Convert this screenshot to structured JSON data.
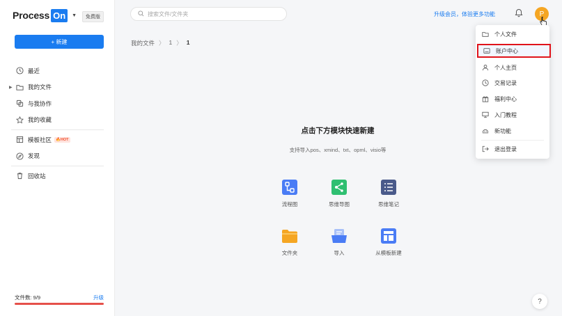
{
  "brand": {
    "logo_text": "Process",
    "logo_on": "On",
    "plan_badge": "免费版"
  },
  "sidebar": {
    "new_button": "+ 新建",
    "items": [
      {
        "label": "最近",
        "icon": "clock-icon"
      },
      {
        "label": "我的文件",
        "icon": "folder-icon"
      },
      {
        "label": "与我协作",
        "icon": "collab-icon"
      },
      {
        "label": "我的收藏",
        "icon": "star-icon"
      },
      {
        "label": "模板社区",
        "icon": "template-icon",
        "badge": "HOT"
      },
      {
        "label": "发现",
        "icon": "compass-icon"
      },
      {
        "label": "回收站",
        "icon": "trash-icon"
      }
    ],
    "files_label": "文件数: 9/9",
    "upgrade_label": "升级",
    "files_used": 9,
    "files_total": 9
  },
  "header": {
    "search_placeholder": "搜索文件/文件夹",
    "upgrade_text": "升级会员，体验更多功能",
    "avatar_letter": "P"
  },
  "breadcrumb": {
    "root": "我的文件",
    "level1": "1",
    "current": "1"
  },
  "main": {
    "title": "点击下方模块快速新建",
    "subtitle": "支持导入pos、xmind、txt、opml、visio等",
    "tiles": [
      {
        "label": "流程图",
        "icon": "flowchart-icon",
        "color": "#4a7cf5"
      },
      {
        "label": "思维导图",
        "icon": "mindmap-icon",
        "color": "#2fbf71"
      },
      {
        "label": "思维笔记",
        "icon": "notes-icon",
        "color": "#4a5a8a"
      },
      {
        "label": "文件夹",
        "icon": "folder-icon",
        "color": "#f5a623"
      },
      {
        "label": "导入",
        "icon": "import-icon",
        "color": "#4a7cf5"
      },
      {
        "label": "从模板新建",
        "icon": "template-icon",
        "color": "#4a7cf5"
      }
    ]
  },
  "menu": {
    "items": [
      {
        "label": "个人文件",
        "icon": "folder-icon"
      },
      {
        "label": "账户中心",
        "icon": "account-icon",
        "highlighted": true
      },
      {
        "label": "个人主页",
        "icon": "user-icon"
      },
      {
        "label": "交易记录",
        "icon": "clock-icon"
      },
      {
        "label": "福利中心",
        "icon": "gift-icon"
      },
      {
        "label": "入门教程",
        "icon": "tutorial-icon"
      },
      {
        "label": "新功能",
        "icon": "new-feature-icon"
      },
      {
        "label": "退出登录",
        "icon": "logout-icon"
      }
    ]
  },
  "help_label": "?"
}
